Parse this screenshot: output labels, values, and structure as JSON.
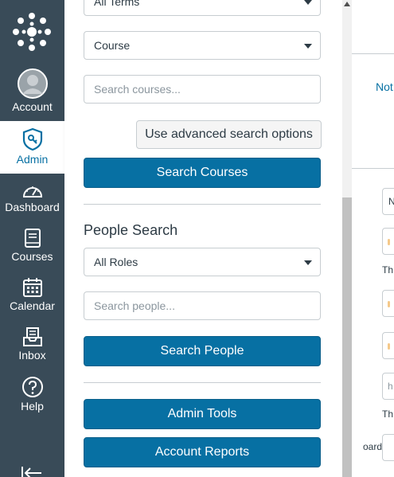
{
  "global_nav": {
    "items": [
      {
        "label": "Account"
      },
      {
        "label": "Admin"
      },
      {
        "label": "Dashboard"
      },
      {
        "label": "Courses"
      },
      {
        "label": "Calendar"
      },
      {
        "label": "Inbox"
      },
      {
        "label": "Help"
      }
    ]
  },
  "tray": {
    "term_select": "All Terms",
    "course_type_select": "Course",
    "course_search_placeholder": "Search courses...",
    "advanced_search_label": "Use advanced search options",
    "search_courses_label": "Search Courses",
    "people_heading": "People Search",
    "roles_select": "All Roles",
    "people_search_placeholder": "Search people...",
    "search_people_label": "Search People",
    "admin_tools_label": "Admin Tools",
    "account_reports_label": "Account Reports"
  },
  "background": {
    "tab_text": "Not",
    "field_text_n": "N",
    "small_1": "Th",
    "field_text_h": "h",
    "small_2": "Th",
    "small_3": "oard:"
  },
  "colors": {
    "nav_bg": "#394b58",
    "primary": "#0770a3"
  }
}
